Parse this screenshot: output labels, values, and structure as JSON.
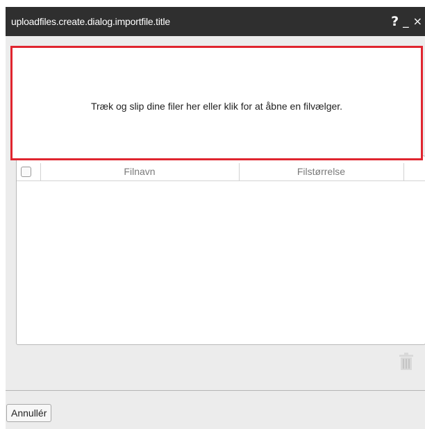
{
  "dialog": {
    "title": "uploadfiles.create.dialog.importfile.title",
    "help_label": "?",
    "minimize_label": "_",
    "close_label": "×"
  },
  "dropzone": {
    "message": "Træk og slip dine filer her eller klik for at åbne en filvælger."
  },
  "file_table": {
    "columns": [
      "Filnavn",
      "Filstørrelse"
    ],
    "rows": []
  },
  "icons": {
    "delete": "trash-icon"
  },
  "footer": {
    "cancel_label": "Annullér"
  },
  "colors": {
    "titlebar": "#2f2f2f",
    "dropzone_border": "#e0252f",
    "dialog_background": "#ececec"
  }
}
